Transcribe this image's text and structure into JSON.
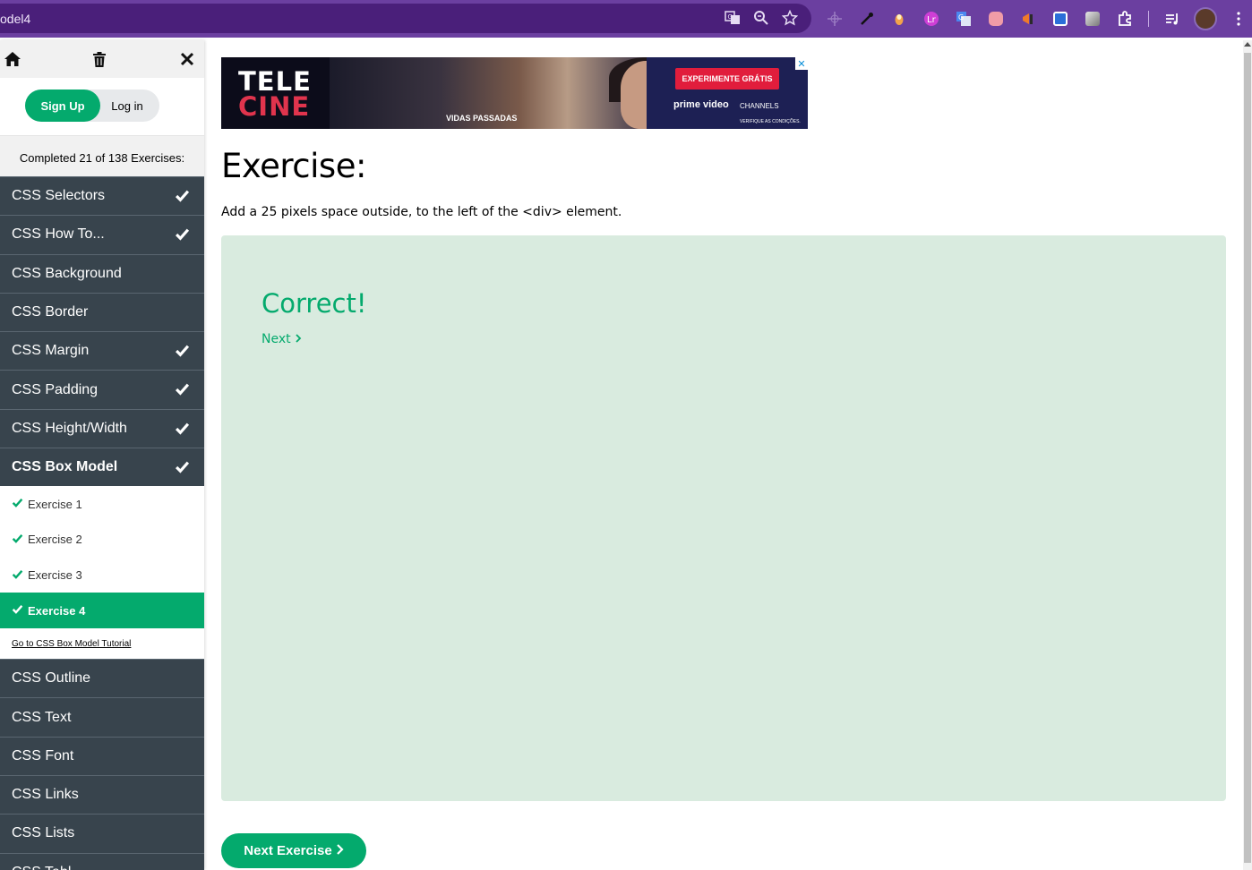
{
  "browser": {
    "url_text": "odel4",
    "icons": [
      "translate-icon",
      "zoom-icon",
      "bookmark-star-icon"
    ],
    "extensions": [
      "extension-crosshair-icon",
      "eyedropper-icon",
      "extension-orange-icon",
      "extension-pink-icon",
      "google-translate-icon",
      "extension-pocket-icon",
      "extension-megaphone-icon",
      "extension-lr-icon",
      "extension-gradient-icon",
      "extensions-puzzle-icon",
      "media-queue-icon",
      "profile-avatar",
      "menu-kebab-icon"
    ]
  },
  "sidebar": {
    "icons": {
      "home": "home-icon",
      "trash": "trash-icon",
      "close": "close-icon"
    },
    "signup_label": "Sign Up",
    "login_label": "Log in",
    "completed_text": "Completed 21 of 138 Exercises:",
    "items": [
      {
        "label": "CSS Selectors",
        "done": true
      },
      {
        "label": "CSS How To...",
        "done": true
      },
      {
        "label": "CSS Background",
        "done": false
      },
      {
        "label": "CSS Border",
        "done": false
      },
      {
        "label": "CSS Margin",
        "done": true
      },
      {
        "label": "CSS Padding",
        "done": true
      },
      {
        "label": "CSS Height/Width",
        "done": true
      },
      {
        "label": "CSS Box Model",
        "done": true,
        "active": true
      }
    ],
    "sub_items": [
      {
        "label": "Exercise 1",
        "done": true
      },
      {
        "label": "Exercise 2",
        "done": true
      },
      {
        "label": "Exercise 3",
        "done": true
      },
      {
        "label": "Exercise 4",
        "done": true,
        "current": true
      }
    ],
    "tutorial_link": "Go to CSS Box Model Tutorial",
    "items_after": [
      {
        "label": "CSS Outline"
      },
      {
        "label": "CSS Text"
      },
      {
        "label": "CSS Font"
      },
      {
        "label": "CSS Links"
      },
      {
        "label": "CSS Lists"
      },
      {
        "label": "CSS Tabl"
      }
    ]
  },
  "ad": {
    "logo_line1": "TELE",
    "logo_line2": "CINE",
    "caption": "VIDAS PASSADAS",
    "cta": "EXPERIMENTE GRÁTIS",
    "prime": "prime video",
    "channels": "CHANNELS",
    "verify": "VERIFIQUE AS CONDIÇÕES.",
    "close": "✕"
  },
  "main": {
    "title": "Exercise:",
    "description": "Add a 25 pixels space outside, to the left of the <div> element.",
    "result_text": "Correct!",
    "next_link": "Next",
    "next_exercise_button": "Next Exercise"
  },
  "colors": {
    "accent_green": "#04aa6d",
    "nav_dark": "#38444d",
    "panel_bg": "#d9ebdf",
    "browser_purple": "#6b3fa0"
  }
}
